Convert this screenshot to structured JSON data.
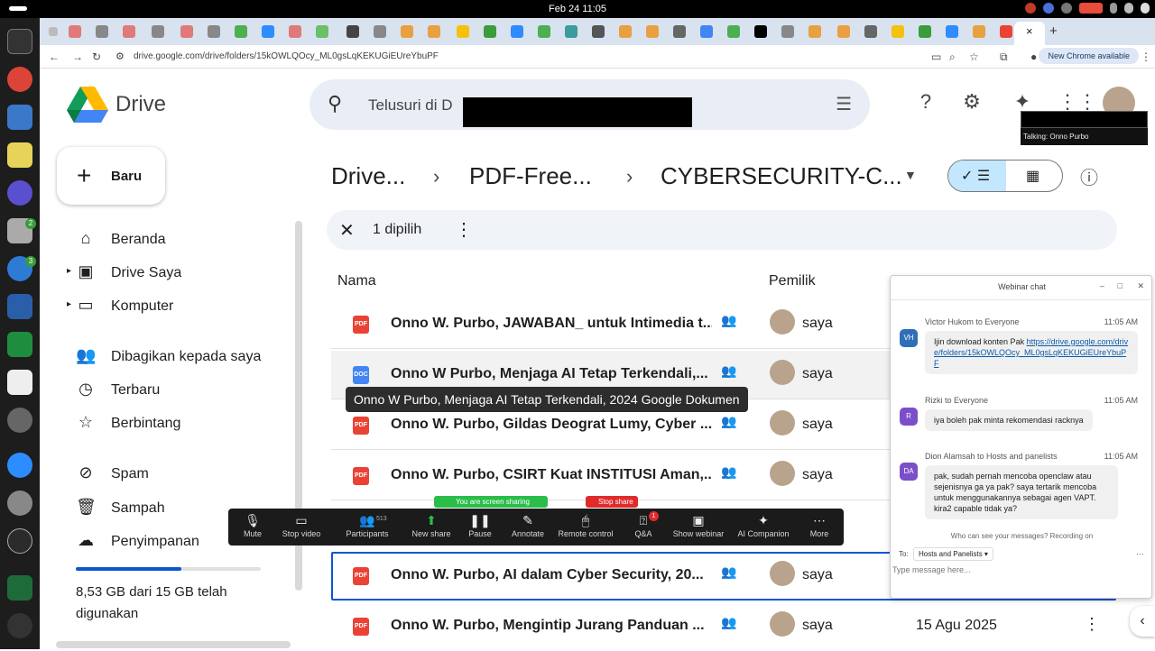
{
  "system": {
    "clock": "Feb 24  11:05"
  },
  "browser": {
    "url": "drive.google.com/drive/folders/15kOWLQOcy_ML0gsLqKEKUGiEUreYbuPF",
    "new_chrome_label": "New Chrome available",
    "tab_close": "×",
    "tab_new": "+"
  },
  "drive": {
    "brand": "Drive",
    "search_placeholder": "Telusuri di D",
    "new_label": "Baru",
    "nav": [
      {
        "label": "Beranda",
        "icon": "home-icon"
      },
      {
        "label": "Drive Saya",
        "icon": "my-drive-icon"
      },
      {
        "label": "Komputer",
        "icon": "computer-icon"
      },
      {
        "label": "Dibagikan kepada saya",
        "icon": "shared-icon"
      },
      {
        "label": "Terbaru",
        "icon": "clock-icon"
      },
      {
        "label": "Berbintang",
        "icon": "star-icon"
      },
      {
        "label": "Spam",
        "icon": "spam-icon"
      },
      {
        "label": "Sampah",
        "icon": "trash-icon"
      },
      {
        "label": "Penyimpanan",
        "icon": "cloud-icon"
      }
    ],
    "storage_text": "8,53 GB dari 15 GB telah digunakan",
    "storage_fraction": 0.569,
    "breadcrumb": [
      "Drive...",
      "PDF-Free...",
      "CYBERSECURITY-C..."
    ],
    "selection_text": "1 dipilih",
    "columns": {
      "name": "Nama",
      "owner": "Pemilik"
    },
    "files": [
      {
        "name": "Onno W. Purbo, JAWABAN_ untuk Intimedia t...",
        "type": "PDF",
        "owner": "saya",
        "date": ""
      },
      {
        "name": "Onno W Purbo, Menjaga AI Tetap Terkendali,...",
        "type": "DOC",
        "owner": "saya",
        "date": ""
      },
      {
        "name": "Onno W. Purbo, Gildas Deograt Lumy, Cyber ...",
        "type": "PDF",
        "owner": "saya",
        "date": ""
      },
      {
        "name": "Onno W. Purbo, CSIRT Kuat INSTITUSI Aman,...",
        "type": "PDF",
        "owner": "saya",
        "date": ""
      },
      {
        "name": "Onno W. Purbo, AI dalam Cyber Security, 20...",
        "type": "PDF",
        "owner": "saya",
        "date": ""
      },
      {
        "name": "Onno W. Purbo, Mengintip Jurang  Panduan ...",
        "type": "PDF",
        "owner": "saya",
        "date": "15 Agu 2025"
      }
    ],
    "tooltip": "Onno W Purbo, Menjaga AI Tetap Terkendali, 2024 Google Dokumen"
  },
  "zoom": {
    "sharing_banner": "You are screen sharing",
    "stop_share": "Stop share",
    "participants_count": "513",
    "qa_badge": "1",
    "buttons": [
      "Mute",
      "Stop video",
      "Participants",
      "New share",
      "Pause",
      "Annotate",
      "Remote control",
      "Q&A",
      "Show webinar",
      "AI Companion",
      "More"
    ],
    "talking": "Talking: Onno Purbo",
    "chat": {
      "title": "Webinar chat",
      "messages": [
        {
          "initials": "VH",
          "from": "Victor Hukom to Everyone",
          "time": "11:05 AM",
          "text": "Ijin download konten Pak ",
          "link": "https://drive.google.com/drive/folders/15kOWLQOcy_ML0gsLqKEKUGiEUreYbuPF",
          "color": "#2f6fb8"
        },
        {
          "initials": "R",
          "from": "Rizki to Everyone",
          "time": "11:05 AM",
          "text": "iya boleh pak minta rekomendasi racknya",
          "color": "#7b4fc9"
        },
        {
          "initials": "DA",
          "from": "Dion Alamsah to Hosts and panelists",
          "time": "11:05 AM",
          "text": "pak, sudah pernah mencoba openclaw atau sejenisnya ga ya pak? saya tertarik mencoba untuk menggunakannya sebagai agen VAPT. kira2 capable tidak ya?",
          "color": "#7b4fc9"
        }
      ],
      "note": "Who can see your messages? Recording on",
      "to_label": "To:",
      "to_value": "Hosts and Panelists",
      "input_placeholder": "Type message here..."
    }
  }
}
